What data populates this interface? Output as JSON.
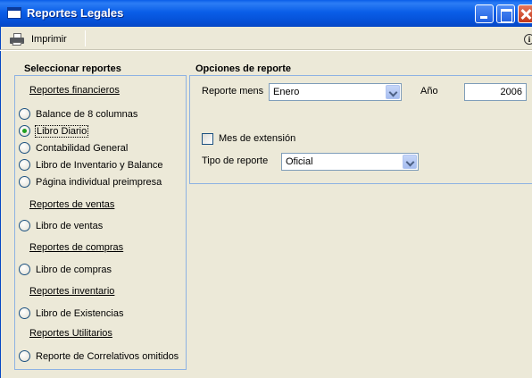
{
  "window": {
    "title": "Reportes Legales"
  },
  "toolbar": {
    "print_label": "Imprimir"
  },
  "left": {
    "heading": "Seleccionar reportes",
    "groups": [
      {
        "label": "Reportes financieros",
        "items": [
          "Balance de 8 columnas",
          "Libro Diario",
          "Contabilidad General",
          "Libro de Inventario y Balance",
          "Página individual preimpresa"
        ]
      },
      {
        "label": "Reportes de ventas",
        "items": [
          "Libro de ventas"
        ]
      },
      {
        "label": "Reportes de compras",
        "items": [
          "Libro de compras"
        ]
      },
      {
        "label": "Reportes inventario",
        "items": [
          "Libro de Existencias"
        ]
      },
      {
        "label": "Reportes Utilitarios",
        "items": [
          "Reporte de Correlativos omitidos"
        ]
      }
    ],
    "selected": "Libro Diario"
  },
  "options": {
    "heading": "Opciones de reporte",
    "month_label": "Reporte mens",
    "month_value": "Enero",
    "year_label": "Año",
    "year_value": "2006",
    "extension_label": "Mes de extensión",
    "extension_checked": false,
    "type_label": "Tipo de reporte",
    "type_value": "Oficial"
  }
}
